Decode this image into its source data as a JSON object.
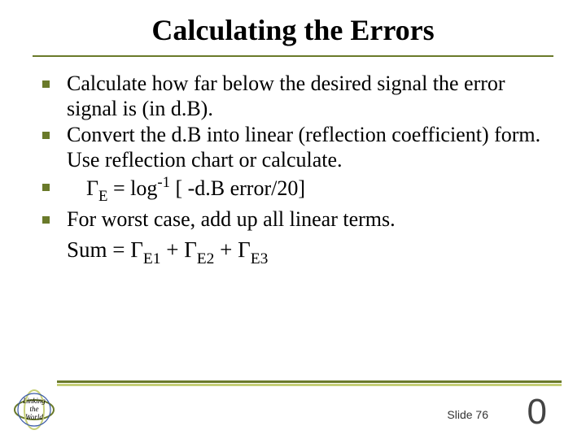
{
  "title": "Calculating the Errors",
  "bullets": [
    "Calculate how far below the desired signal the error signal is (in d.B).",
    "Convert the d.B into linear (reflection coefficient) form. Use reflection chart or calculate.",
    "",
    "For worst case, add up all linear terms."
  ],
  "formula": {
    "prefix": "Γ",
    "sub": "E",
    "mid": " = log",
    "exp": "-1",
    "suffix": "  [ -d.B error/20]"
  },
  "sum_line": {
    "lead": "Sum = ",
    "t1a": "Γ",
    "t1b": "E1",
    "plus1": " + ",
    "t2a": "Γ",
    "t2b": "E2",
    "plus2": " + ",
    "t3a": "Γ",
    "t3b": "E3"
  },
  "footer": {
    "slide_label": "Slide 76",
    "big_zero": "0",
    "logo_line1": "Linking",
    "logo_line2": "the",
    "logo_line3": "World"
  }
}
